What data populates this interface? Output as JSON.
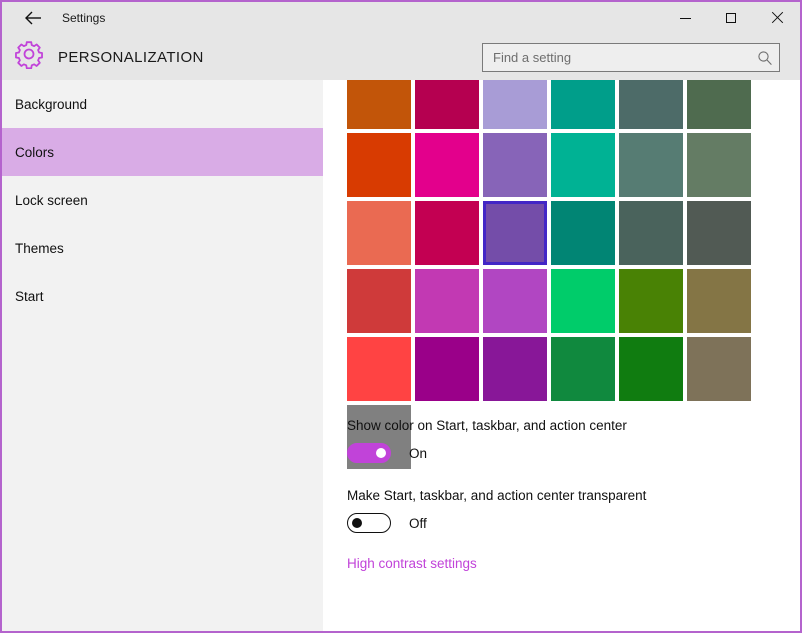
{
  "window": {
    "title": "Settings",
    "border_color": "#b463cd",
    "back_icon": "back-arrow-icon",
    "minimize_label": "—",
    "maximize_label": "□",
    "close_label": "✕"
  },
  "header": {
    "gear_icon": "gear-icon",
    "page_title": "PERSONALIZATION",
    "search": {
      "placeholder": "Find a setting",
      "value": "",
      "icon": "search-icon"
    }
  },
  "sidebar": {
    "items": [
      {
        "label": "Background",
        "selected": false
      },
      {
        "label": "Colors",
        "selected": true
      },
      {
        "label": "Lock screen",
        "selected": false
      },
      {
        "label": "Themes",
        "selected": false
      },
      {
        "label": "Start",
        "selected": false
      }
    ],
    "selected_background": "#d9ace6"
  },
  "main": {
    "accent_colors": {
      "selected_index": 14,
      "selection_border": "#4326c6",
      "rows": [
        [
          "#c25509",
          "#b50050",
          "#a89cd6",
          "#009e8a",
          "#4d6b68",
          "#4f6b4f"
        ],
        [
          "#d83b01",
          "#e3008c",
          "#8764b8",
          "#00b294",
          "#567c73",
          "#647c64"
        ],
        [
          "#ea6a52",
          "#c30052",
          "#744da9",
          "#018574",
          "#4a635c",
          "#515a54"
        ],
        [
          "#cf3a3a",
          "#c239b3",
          "#b146c2",
          "#00cc6a",
          "#498205",
          "#847545"
        ],
        [
          "#ff4343",
          "#9a0089",
          "#881798",
          "#10893e",
          "#107c10",
          "#7e7259"
        ],
        [
          "#808080"
        ]
      ]
    },
    "settings": [
      {
        "label": "Show color on Start, taskbar, and action center",
        "state": "On",
        "on": true
      },
      {
        "label": "Make Start, taskbar, and action center transparent",
        "state": "Off",
        "on": false
      }
    ],
    "link": {
      "label": "High contrast settings",
      "color": "#c143d9"
    }
  }
}
